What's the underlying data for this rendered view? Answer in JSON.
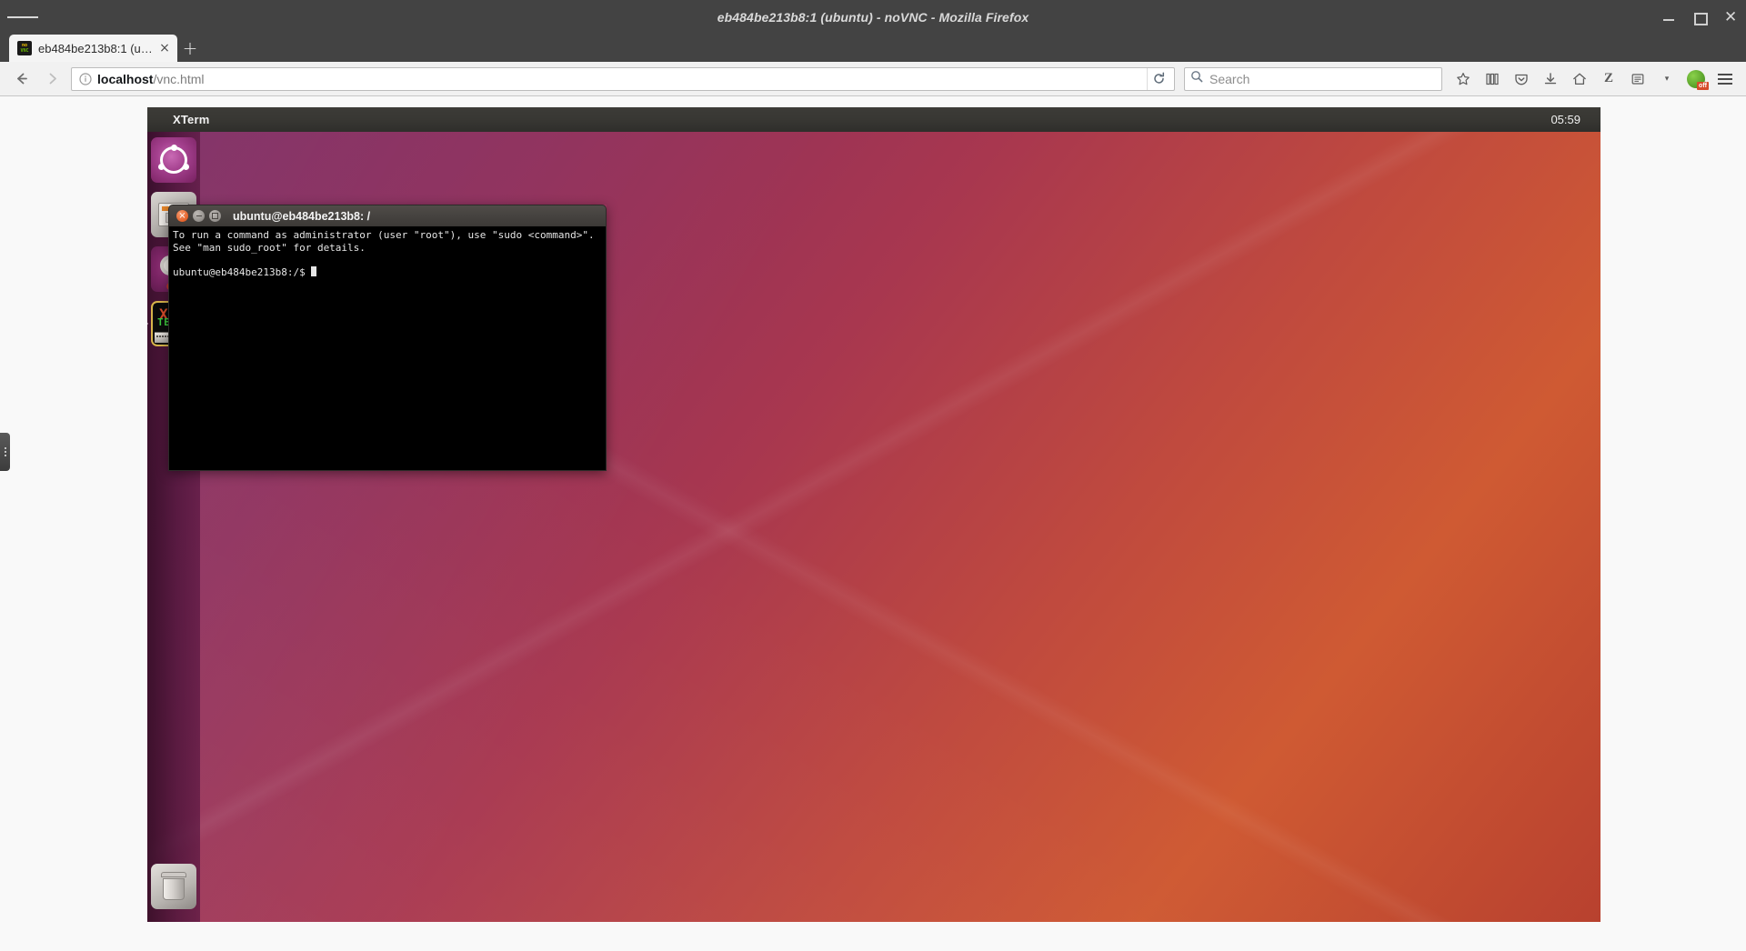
{
  "window": {
    "title": "eb484be213b8:1 (ubuntu) - noVNC - Mozilla Firefox",
    "minimize_label": "Minimize",
    "maximize_label": "Maximize",
    "close_label": "Close",
    "hamburger_label": "Application menu"
  },
  "tabs": [
    {
      "label": "eb484be213b8:1 (u…",
      "favicon": "novnc-favicon",
      "close_label": "×"
    }
  ],
  "newtab_label": "+",
  "navbar": {
    "back_label": "Back",
    "forward_label": "Forward",
    "url": {
      "scheme_prefix": "",
      "host": "localhost",
      "path": "/vnc.html",
      "full": "localhost/vnc.html"
    },
    "identity_icon": "info-icon",
    "reload_label": "Reload",
    "search": {
      "placeholder": "Search",
      "value": "",
      "icon": "search-icon"
    },
    "icons": [
      {
        "name": "bookmark-star-icon",
        "glyph": "☆"
      },
      {
        "name": "library-icon",
        "glyph": "▤"
      },
      {
        "name": "pocket-icon",
        "glyph": "⬣"
      },
      {
        "name": "downloads-icon",
        "glyph": "⬇"
      },
      {
        "name": "home-icon",
        "glyph": "⌂"
      },
      {
        "name": "zotero-icon",
        "glyph": "Z"
      },
      {
        "name": "reader-view-icon",
        "glyph": "▤"
      },
      {
        "name": "chevron-down-icon",
        "glyph": "▾"
      },
      {
        "name": "ublock-origin-icon",
        "glyph": "",
        "badge": "off"
      },
      {
        "name": "firefox-menu-icon",
        "glyph": "☰"
      }
    ]
  },
  "vnc": {
    "drag_handle_label": "noVNC control bar handle",
    "panel": {
      "app_name": "XTerm",
      "clock": "05:59"
    },
    "launcher": {
      "items": [
        {
          "name": "ubuntu-dash-icon",
          "label": "Dash home"
        },
        {
          "name": "files-icon",
          "label": "Files"
        },
        {
          "name": "settings-icon",
          "label": "System Settings"
        },
        {
          "name": "xterm-icon",
          "label": "XTerm",
          "active": true,
          "icon_text_x": "X",
          "icon_text_term": "TERM"
        },
        {
          "name": "trash-icon",
          "label": "Trash"
        }
      ]
    },
    "terminal": {
      "title": "ubuntu@eb484be213b8: /",
      "close_label": "×",
      "minimize_label": "–",
      "maximize_label": "□",
      "line1": "To run a command as administrator (user \"root\"), use \"sudo <command>\".",
      "line2": "See \"man sudo_root\" for details.",
      "prompt": "ubuntu@eb484be213b8:/$ "
    }
  }
}
